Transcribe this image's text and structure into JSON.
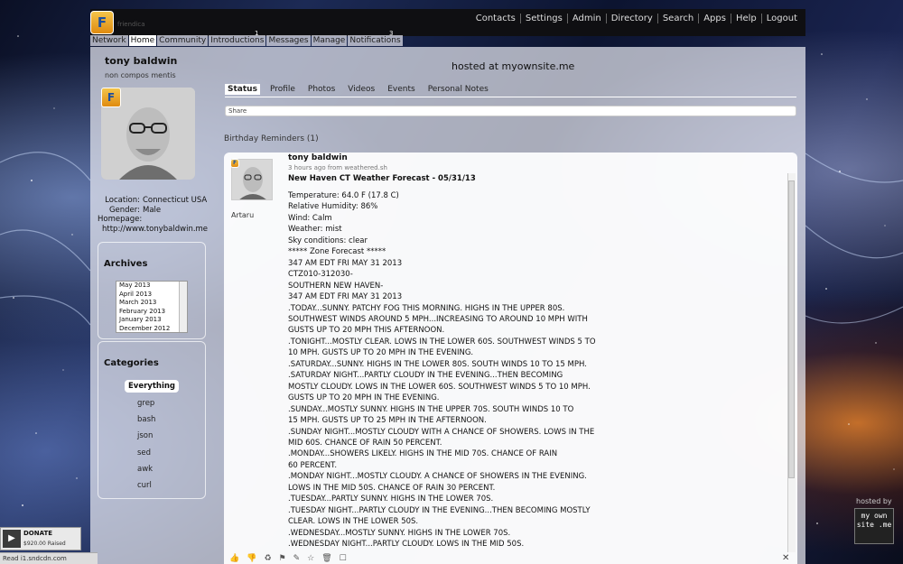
{
  "site": {
    "logo_letter": "F",
    "logo_sub": "friendica",
    "hosted_text": "hosted at myownsite.me",
    "hosted_by": "hosted by",
    "hosted_logo": "my own site .me"
  },
  "topnav": {
    "links": [
      "Contacts",
      "Settings",
      "Admin",
      "Directory",
      "Search",
      "Apps",
      "Help",
      "Logout"
    ]
  },
  "tabs": [
    "Network",
    "Home",
    "Community",
    "Introductions",
    "Messages",
    "Manage",
    "Notifications"
  ],
  "tab_badges": {
    "introductions": "1",
    "notifications": "3"
  },
  "profile": {
    "name": "tony baldwin",
    "tagline": "non compos mentis",
    "location_label": "Location:",
    "location_value": "Connecticut USA",
    "gender_label": "Gender:",
    "gender_value": "Male",
    "homepage_label": "Homepage:",
    "homepage_value": "http://www.tonybaldwin.me"
  },
  "archives": {
    "title": "Archives",
    "items": [
      "May 2013",
      "April 2013",
      "March 2013",
      "February 2013",
      "January 2013",
      "December 2012"
    ]
  },
  "categories": {
    "title": "Categories",
    "items": [
      "Everything",
      "grep",
      "bash",
      "json",
      "sed",
      "awk",
      "curl"
    ]
  },
  "profile_tabs": [
    "Status",
    "Profile",
    "Photos",
    "Videos",
    "Events",
    "Personal Notes"
  ],
  "share": {
    "placeholder": "Share"
  },
  "birthday": "Birthday Reminders (1)",
  "post": {
    "author": "tony baldwin",
    "ago": "3 hours ago from weathered.sh",
    "title": "New Haven CT Weather Forecast - 05/31/13",
    "avatar_user": "Artaru",
    "lines": [
      "Temperature: 64.0 F (17.8 C)",
      "Relative Humidity: 86%",
      "Wind: Calm",
      "Weather: mist",
      "Sky conditions: clear",
      "***** Zone Forecast *****",
      "347 AM EDT FRI MAY 31 2013",
      "CTZ010-312030-",
      "SOUTHERN NEW HAVEN-",
      "347 AM EDT FRI MAY 31 2013",
      ".TODAY...SUNNY. PATCHY FOG THIS MORNING. HIGHS IN THE UPPER 80S.",
      "SOUTHWEST WINDS AROUND 5 MPH...INCREASING TO AROUND 10 MPH WITH",
      "GUSTS UP TO 20 MPH THIS AFTERNOON.",
      ".TONIGHT...MOSTLY CLEAR. LOWS IN THE LOWER 60S. SOUTHWEST WINDS 5 TO",
      "10 MPH. GUSTS UP TO 20 MPH IN THE EVENING.",
      ".SATURDAY...SUNNY. HIGHS IN THE LOWER 80S. SOUTH WINDS 10 TO 15 MPH.",
      ".SATURDAY NIGHT...PARTLY CLOUDY IN THE EVENING...THEN BECOMING",
      "MOSTLY CLOUDY. LOWS IN THE LOWER 60S. SOUTHWEST WINDS 5 TO 10 MPH.",
      "GUSTS UP TO 20 MPH IN THE EVENING.",
      ".SUNDAY...MOSTLY SUNNY. HIGHS IN THE UPPER 70S. SOUTH WINDS 10 TO",
      "15 MPH. GUSTS UP TO 25 MPH IN THE AFTERNOON.",
      ".SUNDAY NIGHT...MOSTLY CLOUDY WITH A CHANCE OF SHOWERS. LOWS IN THE",
      "MID 60S. CHANCE OF RAIN 50 PERCENT.",
      ".MONDAY...SHOWERS LIKELY. HIGHS IN THE MID 70S. CHANCE OF RAIN",
      "60 PERCENT.",
      ".MONDAY NIGHT...MOSTLY CLOUDY. A CHANCE OF SHOWERS IN THE EVENING.",
      "LOWS IN THE MID 50S. CHANCE OF RAIN 30 PERCENT.",
      ".TUESDAY...PARTLY SUNNY. HIGHS IN THE LOWER 70S.",
      ".TUESDAY NIGHT...PARTLY CLOUDY IN THE EVENING...THEN BECOMING MOSTLY",
      "CLEAR. LOWS IN THE LOWER 50S.",
      ".WEDNESDAY...MOSTLY SUNNY. HIGHS IN THE LOWER 70S.",
      ".WEDNESDAY NIGHT...PARTLY CLOUDY. LOWS IN THE MID 50S."
    ],
    "actions": [
      "thumbs-up-icon",
      "thumbs-down-icon",
      "share-icon",
      "tag-icon",
      "edit-icon",
      "star-icon",
      "trash-icon",
      "select-icon"
    ]
  },
  "donate": {
    "label": "DONATE",
    "amount": "$920.00 Raised"
  },
  "statusbar": "Read i1.sndcdn.com"
}
